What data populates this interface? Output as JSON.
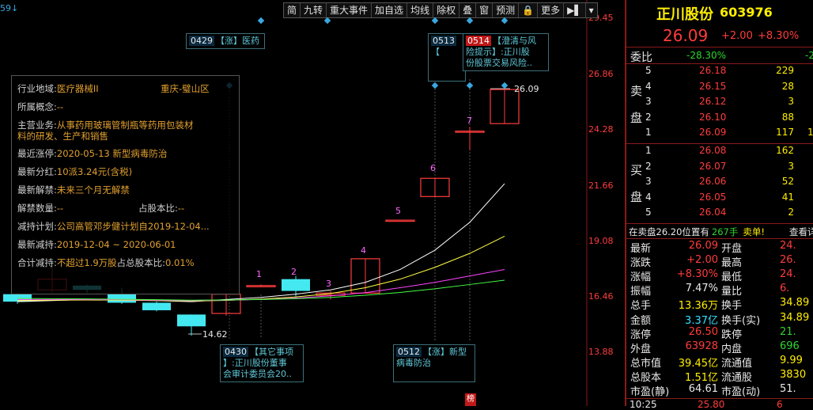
{
  "chart": {
    "corner_label": "59↓",
    "y_axis": [
      "29.45",
      "26.86",
      "24.28",
      "21.66",
      "19.08",
      "16.46",
      "13.88"
    ],
    "high_label": "26.09",
    "low_label": "14.62",
    "candle_markers": [
      "1",
      "2",
      "3",
      "4",
      "5",
      "6",
      "7"
    ],
    "bottom_badge": "榜"
  },
  "chart_data": {
    "type": "candlestick",
    "y_range": [
      13.88,
      29.45
    ],
    "candles": [
      {
        "open": 16.2,
        "close": 16.55,
        "high": 16.6,
        "low": 16.1,
        "dir": "down"
      },
      {
        "open": 16.75,
        "close": 17.25,
        "high": 17.8,
        "low": 16.6,
        "dir": "up"
      },
      {
        "open": 16.95,
        "close": 16.75,
        "high": 17.0,
        "low": 16.6,
        "dir": "down"
      },
      {
        "open": 16.55,
        "close": 16.15,
        "high": 16.85,
        "low": 16.1,
        "dir": "down"
      },
      {
        "open": 16.15,
        "close": 15.8,
        "high": 16.2,
        "low": 15.75,
        "dir": "down"
      },
      {
        "open": 15.6,
        "close": 15.05,
        "high": 15.6,
        "low": 14.62,
        "dir": "down"
      },
      {
        "open": 15.65,
        "close": 16.55,
        "high": 16.6,
        "low": 15.55,
        "dir": "up"
      },
      {
        "open": 16.95,
        "close": 16.95,
        "high": 17.0,
        "low": 16.9,
        "dir": "up"
      },
      {
        "open": 16.7,
        "close": 17.25,
        "high": 17.4,
        "low": 16.4,
        "dir": "down"
      },
      {
        "open": 16.5,
        "close": 16.6,
        "high": 16.7,
        "low": 16.3,
        "dir": "up"
      },
      {
        "open": 16.6,
        "close": 18.2,
        "high": 18.2,
        "low": 16.6,
        "dir": "up"
      },
      {
        "open": 20.0,
        "close": 20.0,
        "high": 20.0,
        "low": 20.0,
        "dir": "up"
      },
      {
        "open": 21.1,
        "close": 21.95,
        "high": 21.95,
        "low": 21.1,
        "dir": "up"
      },
      {
        "open": 24.15,
        "close": 24.15,
        "high": 24.35,
        "low": 23.25,
        "dir": "up"
      },
      {
        "open": 24.5,
        "close": 26.09,
        "high": 26.09,
        "low": 24.5,
        "dir": "up"
      }
    ],
    "series": [
      {
        "name": "MA1",
        "color": "#ffffff",
        "values": [
          16.2,
          16.25,
          16.3,
          16.28,
          16.25,
          16.2,
          16.3,
          16.4,
          16.55,
          16.75,
          17.1,
          17.7,
          18.6,
          19.9,
          21.7
        ]
      },
      {
        "name": "MA2",
        "color": "#ffff44",
        "values": [
          16.25,
          16.27,
          16.28,
          16.27,
          16.25,
          16.23,
          16.26,
          16.32,
          16.42,
          16.58,
          16.85,
          17.25,
          17.8,
          18.45,
          19.25
        ]
      },
      {
        "name": "MA3",
        "color": "#ff44ff",
        "values": [
          16.3,
          16.3,
          16.3,
          16.29,
          16.27,
          16.25,
          16.27,
          16.3,
          16.37,
          16.47,
          16.62,
          16.85,
          17.1,
          17.4,
          17.7
        ]
      },
      {
        "name": "MA4",
        "color": "#44ff44",
        "values": [
          16.35,
          16.34,
          16.33,
          16.31,
          16.29,
          16.27,
          16.28,
          16.3,
          16.34,
          16.4,
          16.5,
          16.63,
          16.8,
          17.0,
          17.2
        ]
      }
    ]
  },
  "toolbar": [
    "简",
    "九转",
    "重大事件",
    "加自选",
    "均线",
    "除权",
    "叠",
    "窗",
    "预测",
    "🔒",
    "更多",
    "▶▌",
    "▾"
  ],
  "flags": {
    "f0429": {
      "date": "0429",
      "text": "【涨】医药"
    },
    "f0513": {
      "date": "0513",
      "text": "【"
    },
    "f0514": {
      "date": "0514",
      "line1": "【澄清与风",
      "line2": "险提示】:正川股",
      "line3": "份股票交易风险.."
    },
    "f0430": {
      "date": "0430",
      "line1": "【其它事项",
      "line2": "】:正川股份董事",
      "line3": "会审计委员会20.."
    },
    "f0512": {
      "date": "0512",
      "line1": "【涨】新型",
      "line2": "病毒防治"
    }
  },
  "info": {
    "industry_k": "行业地域:",
    "industry_v": "医疗器械II",
    "region_v": "重庆-璧山区",
    "concept_k": "所属概念:",
    "concept_v": "--",
    "business_k": "主营业务:",
    "business_v1": "从事药用玻璃管制瓶等药用包装材",
    "business_v2": "料的研发、生产和销售",
    "limit_k": "最近涨停:",
    "limit_v": "2020-05-13 新型病毒防治",
    "div_k": "最新分红:",
    "div_v": "10派3.24元(含税)",
    "unlock_k": "最新解禁:",
    "unlock_v": "未来三个月无解禁",
    "unlock_qty_k": "解禁数量:",
    "unlock_qty_v": "--",
    "ratio_k": "占股本比:",
    "ratio_v": "--",
    "plan_k": "减持计划:",
    "plan_v": "公司高管邓步健计划自2019-12-04...",
    "latest_k": "最新减持:",
    "latest_v": "2019-12-04 ~ 2020-06-01",
    "total_k": "合计减持:",
    "total_v": "不超过1.9万股",
    "total_ratio_k": "占总股本比:",
    "total_ratio_v": "0.01%"
  },
  "quote": {
    "name": "正川股份",
    "code": "603976",
    "price": "26.09",
    "change": "+2.00",
    "change_pct": "+8.30%",
    "weibi_k": "委比",
    "weibi_v": "-28.30%",
    "weicha_v": "-2",
    "sell_label1": "卖",
    "sell_label2": "盘",
    "buy_label1": "买",
    "buy_label2": "盘",
    "asks": [
      {
        "lvl": "5",
        "price": "26.18",
        "vol": "229"
      },
      {
        "lvl": "4",
        "price": "26.15",
        "vol": "28"
      },
      {
        "lvl": "3",
        "price": "26.12",
        "vol": "3"
      },
      {
        "lvl": "2",
        "price": "26.10",
        "vol": "88"
      },
      {
        "lvl": "1",
        "price": "26.09",
        "vol": "117"
      }
    ],
    "ask_trail": [
      "",
      "",
      "",
      "",
      "1"
    ],
    "bids": [
      {
        "lvl": "1",
        "price": "26.08",
        "vol": "162"
      },
      {
        "lvl": "2",
        "price": "26.07",
        "vol": "3"
      },
      {
        "lvl": "3",
        "price": "26.06",
        "vol": "52"
      },
      {
        "lvl": "4",
        "price": "26.05",
        "vol": "41"
      },
      {
        "lvl": "5",
        "price": "26.04",
        "vol": "2"
      }
    ],
    "notice_a": "在卖盘26.20位置有",
    "notice_b": "267手",
    "notice_c": "卖单!",
    "notice_d": "查看详",
    "stats": [
      {
        "k1": "最新",
        "v1": "26.09",
        "k2": "开盘",
        "v2": "24.",
        "c1": "red",
        "c2": "red"
      },
      {
        "k1": "涨跌",
        "v1": "+2.00",
        "k2": "最高",
        "v2": "26.",
        "c1": "red",
        "c2": "red"
      },
      {
        "k1": "涨幅",
        "v1": "+8.30%",
        "k2": "最低",
        "v2": "24.",
        "c1": "red",
        "c2": "red"
      },
      {
        "k1": "振幅",
        "v1": "7.47%",
        "k2": "量比",
        "v2": "6.",
        "c1": "white",
        "c2": "red"
      },
      {
        "k1": "总手",
        "v1": "13.36万",
        "k2": "换手",
        "v2": "34.89",
        "c1": "yellow",
        "c2": "yellow"
      },
      {
        "k1": "金额",
        "v1": "3.37亿",
        "k2": "换手(实)",
        "v2": "34.89",
        "c1": "cyan",
        "c2": "yellow"
      },
      {
        "k1": "涨停",
        "v1": "26.50",
        "k2": "跌停",
        "v2": "21.",
        "c1": "red",
        "c2": "green"
      },
      {
        "k1": "外盘",
        "v1": "63928",
        "k2": "内盘",
        "v2": "696",
        "c1": "red",
        "c2": "green"
      },
      {
        "k1": "总市值",
        "v1": "39.45亿",
        "k2": "流通值",
        "v2": "9.99",
        "c1": "yellow",
        "c2": "yellow"
      },
      {
        "k1": "总股本",
        "v1": "1.51亿",
        "k2": "流通股",
        "v2": "3830",
        "c1": "yellow",
        "c2": "yellow"
      },
      {
        "k1": "市盈(静)",
        "v1": "64.61",
        "k2": "市盈(动)",
        "v2": "51.",
        "c1": "white",
        "c2": "white"
      }
    ],
    "tick_time": "10:25",
    "tick_price": "25.80",
    "tick_vol": "6"
  }
}
